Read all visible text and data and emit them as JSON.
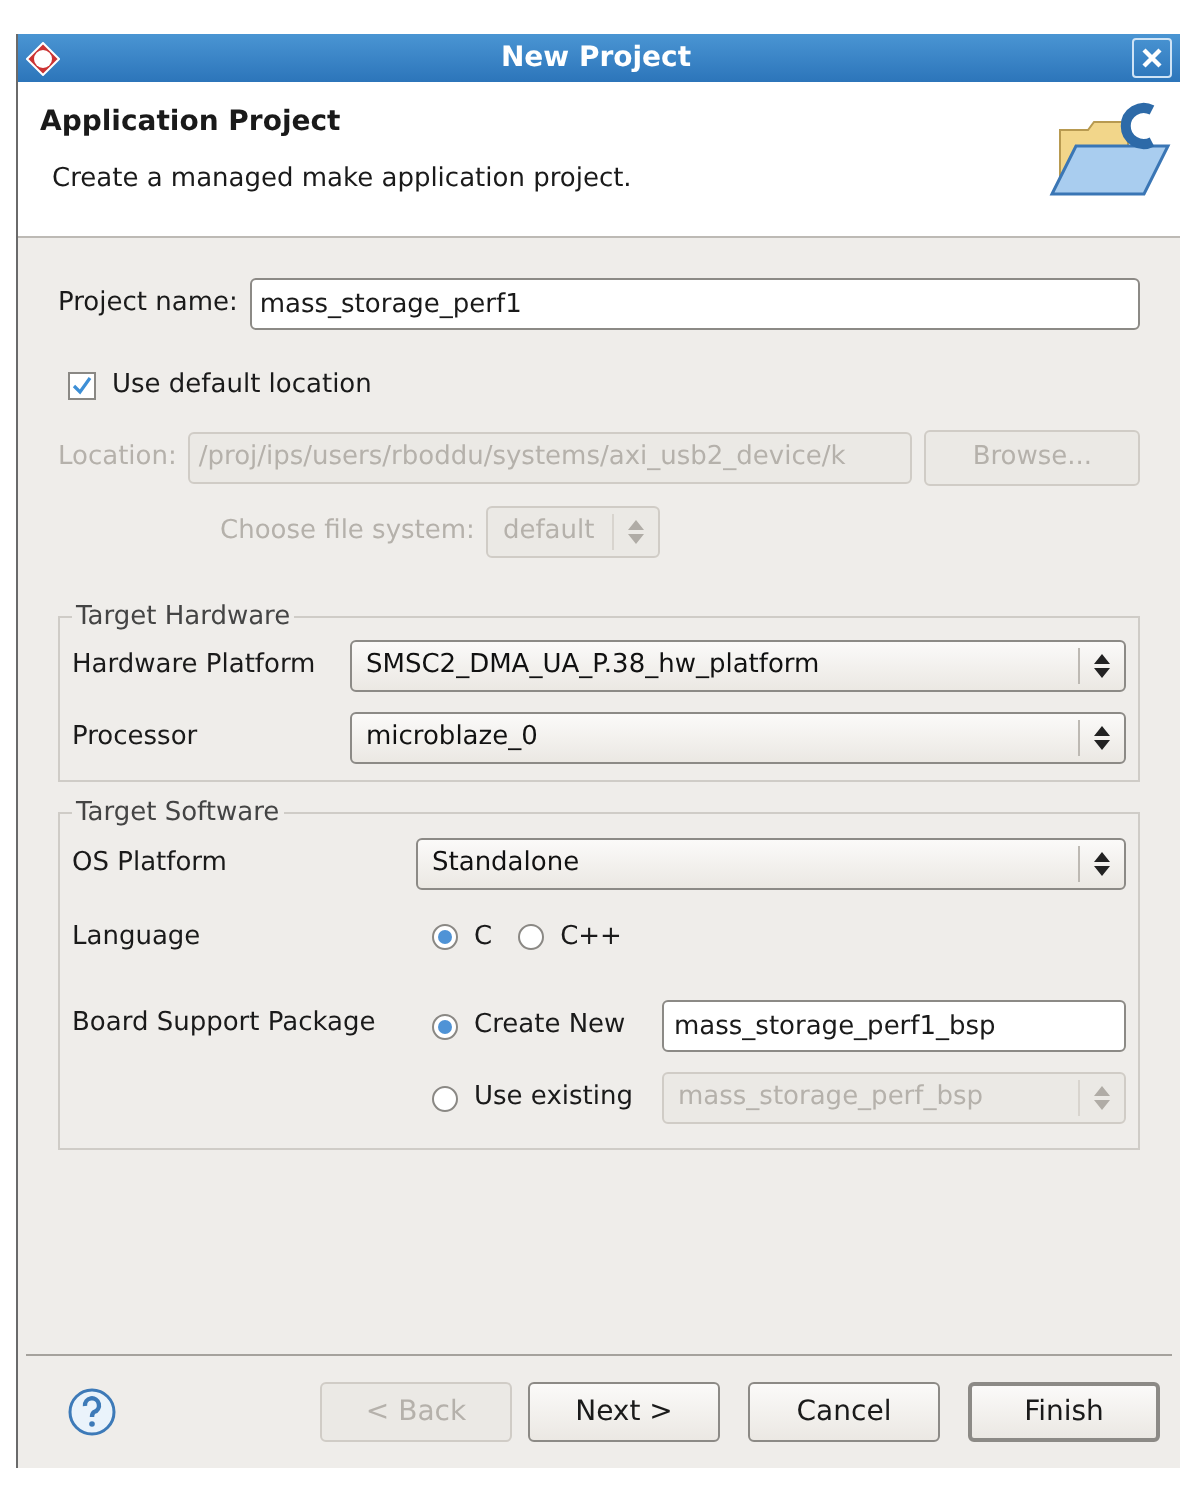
{
  "window": {
    "title": "New Project"
  },
  "header": {
    "title": "Application Project",
    "description": "Create a managed make application project."
  },
  "project_name": {
    "label": "Project name:",
    "value": "mass_storage_perf1"
  },
  "use_default_location": {
    "label": "Use default location",
    "checked": true
  },
  "location": {
    "label": "Location:",
    "value": "/proj/ips/users/rboddu/systems/axi_usb2_device/k",
    "disabled": true,
    "browse": "Browse..."
  },
  "file_system": {
    "label": "Choose file system:",
    "value": "default",
    "disabled": true
  },
  "target_hardware": {
    "title": "Target Hardware",
    "fields": [
      {
        "label": "Hardware Platform",
        "value": "SMSC2_DMA_UA_P.38_hw_platform"
      },
      {
        "label": "Processor",
        "value": "microblaze_0"
      }
    ]
  },
  "target_software": {
    "title": "Target Software",
    "os_platform": {
      "label": "OS Platform",
      "value": "Standalone"
    },
    "language": {
      "label": "Language",
      "options": [
        {
          "label": "C",
          "selected": true
        },
        {
          "label": "C++",
          "selected": false
        }
      ]
    },
    "bsp": {
      "label": "Board Support Package",
      "options": [
        {
          "label": "Create New",
          "selected": true,
          "kind": "text",
          "value": "mass_storage_perf1_bsp",
          "disabled": false
        },
        {
          "label": "Use existing",
          "selected": false,
          "kind": "select",
          "value": "mass_storage_perf_bsp",
          "disabled": true
        }
      ]
    }
  },
  "buttons": [
    {
      "label": "< Back",
      "disabled": true,
      "default": false
    },
    {
      "label": "Next >",
      "disabled": false,
      "default": false
    },
    {
      "label": "Cancel",
      "disabled": false,
      "default": false
    },
    {
      "label": "Finish",
      "disabled": false,
      "default": true
    }
  ]
}
